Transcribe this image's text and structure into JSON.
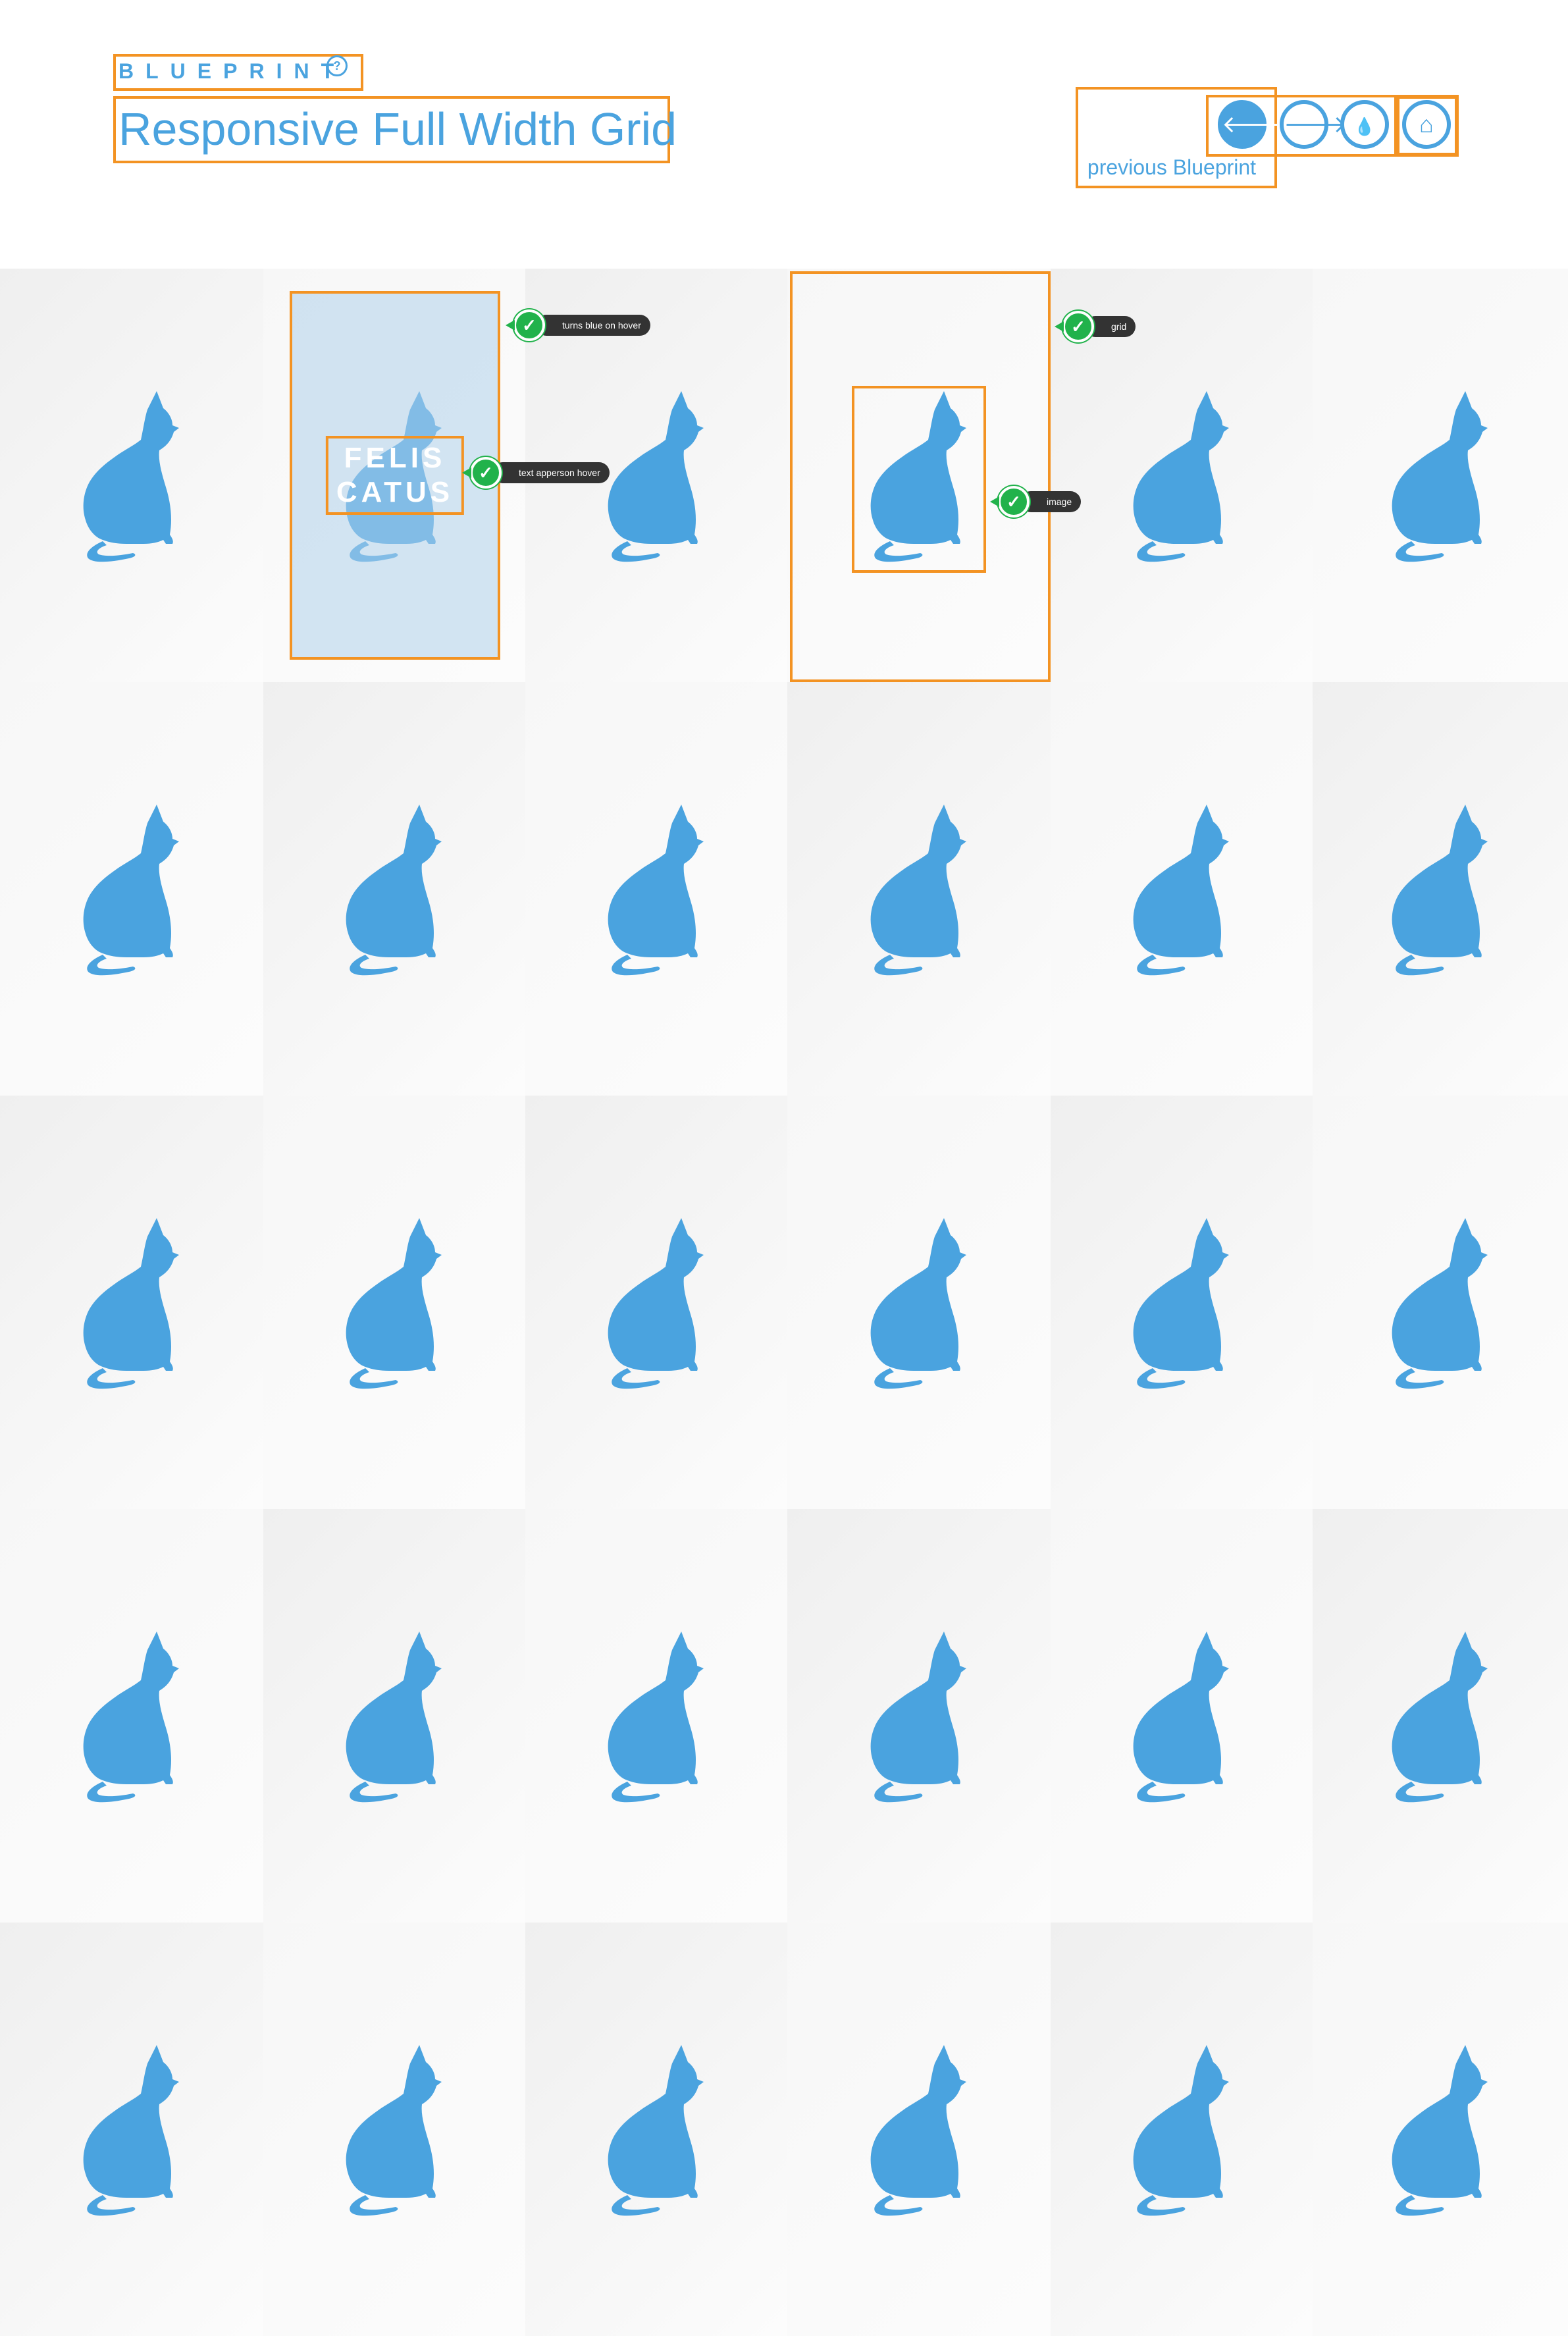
{
  "header": {
    "eyebrow": "BLUEPRINT",
    "help_icon": "?",
    "title": "Responsive Full Width Grid",
    "prev_caption": "previous Blueprint"
  },
  "nav": {
    "prev_icon": "🡐",
    "next_icon": "🡒",
    "drop_icon": "💧",
    "inbox_icon": "⌂"
  },
  "hover_cell": {
    "line1": "FELIS",
    "line2": "CATUS"
  },
  "annotations": {
    "hover_blue": "turns blue on hover",
    "text_hover": "text apperson hover",
    "grid": "grid",
    "image": "image"
  },
  "colors": {
    "accent": "#4aa3df",
    "annotation_box": "#f39323",
    "check": "#21b24b"
  },
  "grid": {
    "rows": 5,
    "cols": 6,
    "tile_icon": "cat-silhouette-icon"
  }
}
